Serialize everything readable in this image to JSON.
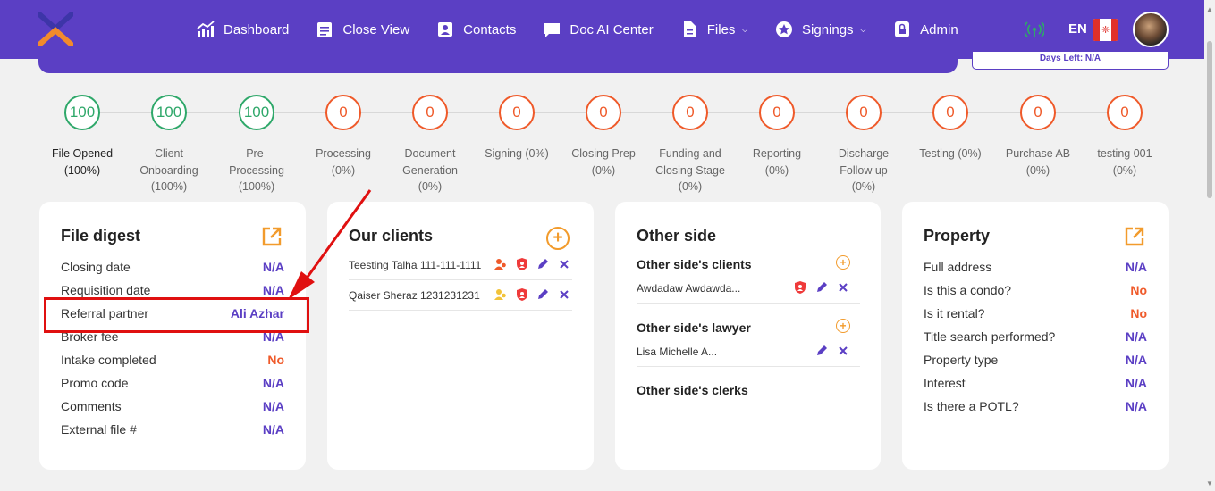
{
  "nav": {
    "items": [
      {
        "label": "Dashboard",
        "icon": "dashboard-chart-icon",
        "dropdown": false
      },
      {
        "label": "Close View",
        "icon": "checklist-icon",
        "dropdown": false
      },
      {
        "label": "Contacts",
        "icon": "contact-card-icon",
        "dropdown": false
      },
      {
        "label": "Doc AI Center",
        "icon": "message-icon",
        "dropdown": false
      },
      {
        "label": "Files",
        "icon": "file-icon",
        "dropdown": true
      },
      {
        "label": "Signings",
        "icon": "star-badge-icon",
        "dropdown": true
      },
      {
        "label": "Admin",
        "icon": "lock-icon",
        "dropdown": false
      }
    ],
    "language": "EN",
    "days_left": "Days Left: N/A"
  },
  "colors": {
    "brand": "#5b3fc4",
    "done": "#2fa86a",
    "pending": "#ef5a2a",
    "accent": "#f29b2c",
    "highlight": "#e01010"
  },
  "steps": [
    {
      "value": "100",
      "label": "File Opened (100%)",
      "done": true
    },
    {
      "value": "100",
      "label": "Client Onboarding (100%)",
      "done": true
    },
    {
      "value": "100",
      "label": "Pre-Processing (100%)",
      "done": true
    },
    {
      "value": "0",
      "label": "Processing (0%)",
      "done": false
    },
    {
      "value": "0",
      "label": "Document Generation (0%)",
      "done": false
    },
    {
      "value": "0",
      "label": "Signing (0%)",
      "done": false
    },
    {
      "value": "0",
      "label": "Closing Prep (0%)",
      "done": false
    },
    {
      "value": "0",
      "label": "Funding and Closing Stage (0%)",
      "done": false
    },
    {
      "value": "0",
      "label": "Reporting (0%)",
      "done": false
    },
    {
      "value": "0",
      "label": "Discharge Follow up (0%)",
      "done": false
    },
    {
      "value": "0",
      "label": "Testing (0%)",
      "done": false
    },
    {
      "value": "0",
      "label": "Purchase AB (0%)",
      "done": false
    },
    {
      "value": "0",
      "label": "testing 001 (0%)",
      "done": false
    }
  ],
  "file_digest": {
    "title": "File digest",
    "rows": [
      {
        "key": "Closing date",
        "value": "N/A"
      },
      {
        "key": "Requisition date",
        "value": "N/A"
      },
      {
        "key": "Referral partner",
        "value": "Ali Azhar"
      },
      {
        "key": "Broker fee",
        "value": "N/A"
      },
      {
        "key": "Intake completed",
        "value": "No"
      },
      {
        "key": "Promo code",
        "value": "N/A"
      },
      {
        "key": "Comments",
        "value": "N/A"
      },
      {
        "key": "External file #",
        "value": "N/A"
      }
    ]
  },
  "our_clients": {
    "title": "Our clients",
    "clients": [
      {
        "name": "Teesting Talha 111-111-1111"
      },
      {
        "name": "Qaiser Sheraz 1231231231"
      }
    ]
  },
  "other_side": {
    "title": "Other side",
    "clients_title": "Other side's clients",
    "clients": [
      {
        "name": "Awdadaw Awdawda..."
      }
    ],
    "lawyer_title": "Other side's lawyer",
    "lawyers": [
      {
        "name": "Lisa Michelle A..."
      }
    ],
    "clerks_title": "Other side's clerks"
  },
  "property": {
    "title": "Property",
    "rows": [
      {
        "key": "Full address",
        "value": "N/A"
      },
      {
        "key": "Is this a condo?",
        "value": "No"
      },
      {
        "key": "Is it rental?",
        "value": "No"
      },
      {
        "key": "Title search performed?",
        "value": "N/A"
      },
      {
        "key": "Property type",
        "value": "N/A"
      },
      {
        "key": "Interest",
        "value": "N/A"
      },
      {
        "key": "Is there a POTL?",
        "value": "N/A"
      }
    ]
  }
}
